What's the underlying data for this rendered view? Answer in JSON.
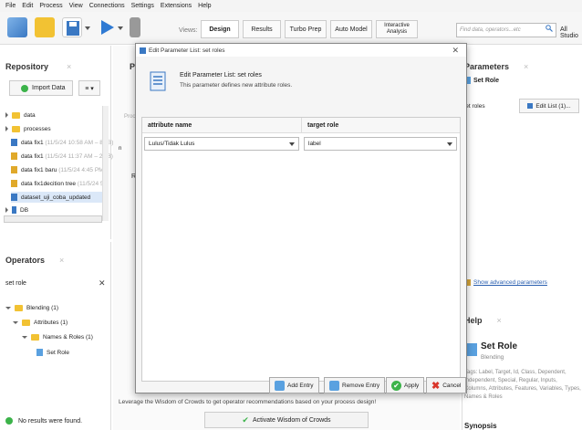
{
  "menu": [
    "File",
    "Edit",
    "Process",
    "View",
    "Connections",
    "Settings",
    "Extensions",
    "Help"
  ],
  "toolbar": {
    "views_label": "Views:",
    "tabs": [
      "Design",
      "Results",
      "Turbo Prep",
      "Auto Model",
      "Interactive Analysis"
    ],
    "active_tab": "Design",
    "search_placeholder": "Find data, operators...etc",
    "all_studio": "All Studio"
  },
  "repository": {
    "title": "Repository",
    "import_button": "Import Data",
    "items": [
      {
        "label": "data",
        "meta": ""
      },
      {
        "label": "processes",
        "meta": ""
      },
      {
        "label": "data fix1",
        "meta": "(11/5/24 10:58 AM – 8 kB)"
      },
      {
        "label": "data fix1",
        "meta": "(11/5/24 11:37 AM – 2 kB)"
      },
      {
        "label": "data fix1 baru",
        "meta": "(11/5/24 4:45 PM)"
      },
      {
        "label": "data fix1decition tree",
        "meta": "(11/5/24 5"
      },
      {
        "label": "dataset_uji_coba_updated",
        "meta": ""
      },
      {
        "label": "DB",
        "meta": ""
      }
    ]
  },
  "operators": {
    "title": "Operators",
    "search_value": "set role",
    "tree": [
      "Blending (1)",
      "Attributes (1)",
      "Names & Roles (1)",
      "Set Role"
    ],
    "status": "No results were found."
  },
  "process_panel": {
    "title_fragment": "Pr",
    "side_fragment": "Re",
    "side_label": "Proc",
    "port_fragment": "n",
    "wisdom_text": "Leverage the Wisdom of Crowds to get operator recommendations based on your process design!",
    "activate_button": "Activate Wisdom of Crowds"
  },
  "parameters": {
    "title": "Parameters",
    "operator": "Set Role",
    "row_label": "set roles",
    "edit_button": "Edit List (1)...",
    "advanced_link": "Show advanced parameters"
  },
  "help": {
    "title": "Help",
    "operator": "Set Role",
    "category": "Blending",
    "tags": "Tags: Label, Target, Id, Class, Dependent, Independent, Special, Regular, Inputs, Columns, Attributes, Features, Variables, Types, Names & Roles",
    "synopsis": "Synopsis"
  },
  "dialog": {
    "title": "Edit Parameter List: set roles",
    "heading": "Edit Parameter List: set roles",
    "subheading": "This parameter defines new attribute roles.",
    "col_attribute": "attribute name",
    "col_role": "target role",
    "row": {
      "attribute": "Lulus/Tidak Lulus",
      "role": "label"
    },
    "buttons": {
      "add": "Add Entry",
      "remove": "Remove Entry",
      "apply": "Apply",
      "cancel": "Cancel"
    }
  },
  "colors": {
    "accent": "#3a78c3",
    "folder": "#f2c233",
    "apply": "#3cb34a",
    "cancel": "#d9362b"
  }
}
